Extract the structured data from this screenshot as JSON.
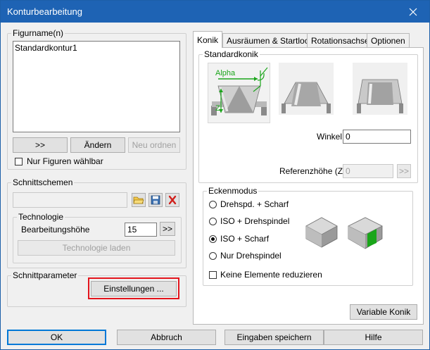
{
  "window": {
    "title": "Konturbearbeitung"
  },
  "figures": {
    "group_label": "Figurname(n)",
    "items": [
      "Standardkontur1"
    ],
    "btn_next": ">>",
    "btn_change": "Ändern",
    "btn_reorder": "Neu ordnen",
    "only_figures_label": "Nur Figuren wählbar"
  },
  "schemes": {
    "group_label": "Schnittschemen",
    "input_value": "",
    "icons": [
      "open-folder-icon",
      "save-icon",
      "delete-icon"
    ]
  },
  "technology": {
    "group_label": "Technologie",
    "height_label": "Bearbeitungshöhe",
    "height_value": "15",
    "btn_next": ">>",
    "btn_load": "Technologie laden"
  },
  "cut_params": {
    "group_label": "Schnittparameter",
    "btn_settings": "Einstellungen ...",
    "highlight_color": "#e3141c"
  },
  "tabs": [
    "Konik",
    "Ausräumen & Startloch",
    "Rotationsachse",
    "Optionen"
  ],
  "active_tab": "Konik",
  "konik": {
    "group_label": "Standardkonik",
    "diagram_alpha": "Alpha",
    "diagram_z": "Z",
    "angle_label": "Winkel",
    "angle_value": "0",
    "ref_height_label": "Referenzhöhe (Z)",
    "ref_height_value": "0",
    "btn_next": ">>"
  },
  "corner": {
    "group_label": "Eckenmodus",
    "options": [
      "Drehspd. + Scharf",
      "ISO + Drehspindel",
      "ISO + Scharf",
      "Nur Drehspindel"
    ],
    "selected": "ISO + Scharf",
    "reduce_label": "Keine Elemente reduzieren"
  },
  "btn_variable": "Variable Konik",
  "footer": {
    "ok": "OK",
    "cancel": "Abbruch",
    "save": "Eingaben speichern",
    "help": "Hilfe"
  },
  "colors": {
    "titlebar": "#1e63b4",
    "accent_green": "#1aa51a"
  }
}
